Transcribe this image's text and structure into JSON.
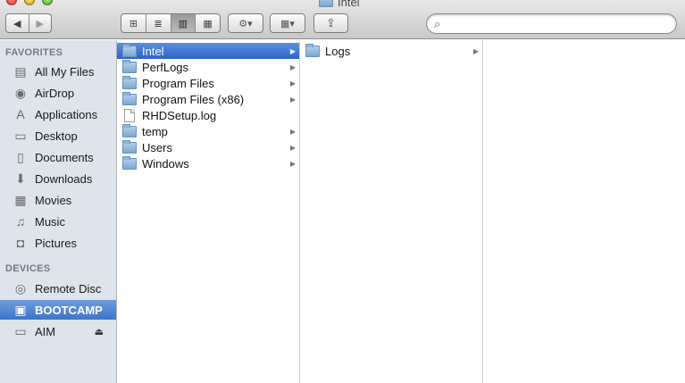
{
  "window": {
    "title": "Intel"
  },
  "toolbar": {
    "back": "◀",
    "forward": "▶",
    "view_icons": "⊞",
    "view_list": "≣",
    "view_columns": "▥",
    "view_coverflow": "▦",
    "action": "⚙▾",
    "arrange": "▦▾",
    "share": "⇪"
  },
  "search": {
    "value": "",
    "placeholder": ""
  },
  "sidebar": {
    "favorites_header": "FAVORITES",
    "devices_header": "DEVICES",
    "favorites": [
      {
        "label": "All My Files",
        "icon": "all-files-icon"
      },
      {
        "label": "AirDrop",
        "icon": "airdrop-icon"
      },
      {
        "label": "Applications",
        "icon": "applications-icon"
      },
      {
        "label": "Desktop",
        "icon": "desktop-icon"
      },
      {
        "label": "Documents",
        "icon": "documents-icon"
      },
      {
        "label": "Downloads",
        "icon": "downloads-icon"
      },
      {
        "label": "Movies",
        "icon": "movies-icon"
      },
      {
        "label": "Music",
        "icon": "music-icon"
      },
      {
        "label": "Pictures",
        "icon": "pictures-icon"
      }
    ],
    "devices": [
      {
        "label": "Remote Disc",
        "icon": "remote-disc-icon"
      },
      {
        "label": "BOOTCAMP",
        "icon": "drive-icon",
        "selected": true
      },
      {
        "label": "AIM",
        "icon": "external-drive-icon",
        "eject": "⏏"
      }
    ]
  },
  "columns": [
    {
      "items": [
        {
          "name": "Intel",
          "type": "folder",
          "selected": true,
          "has_children": true
        },
        {
          "name": "PerfLogs",
          "type": "folder",
          "has_children": true
        },
        {
          "name": "Program Files",
          "type": "folder",
          "has_children": true
        },
        {
          "name": "Program Files (x86)",
          "type": "folder",
          "has_children": true
        },
        {
          "name": "RHDSetup.log",
          "type": "file",
          "has_children": false
        },
        {
          "name": "temp",
          "type": "folder",
          "has_children": true
        },
        {
          "name": "Users",
          "type": "folder",
          "has_children": true
        },
        {
          "name": "Windows",
          "type": "folder",
          "has_children": true
        }
      ]
    },
    {
      "items": [
        {
          "name": "Logs",
          "type": "folder",
          "has_children": true
        }
      ]
    },
    {
      "items": []
    }
  ],
  "colors": {
    "selection": "#3d74c9",
    "sidebar_bg": "#dde4eb"
  }
}
